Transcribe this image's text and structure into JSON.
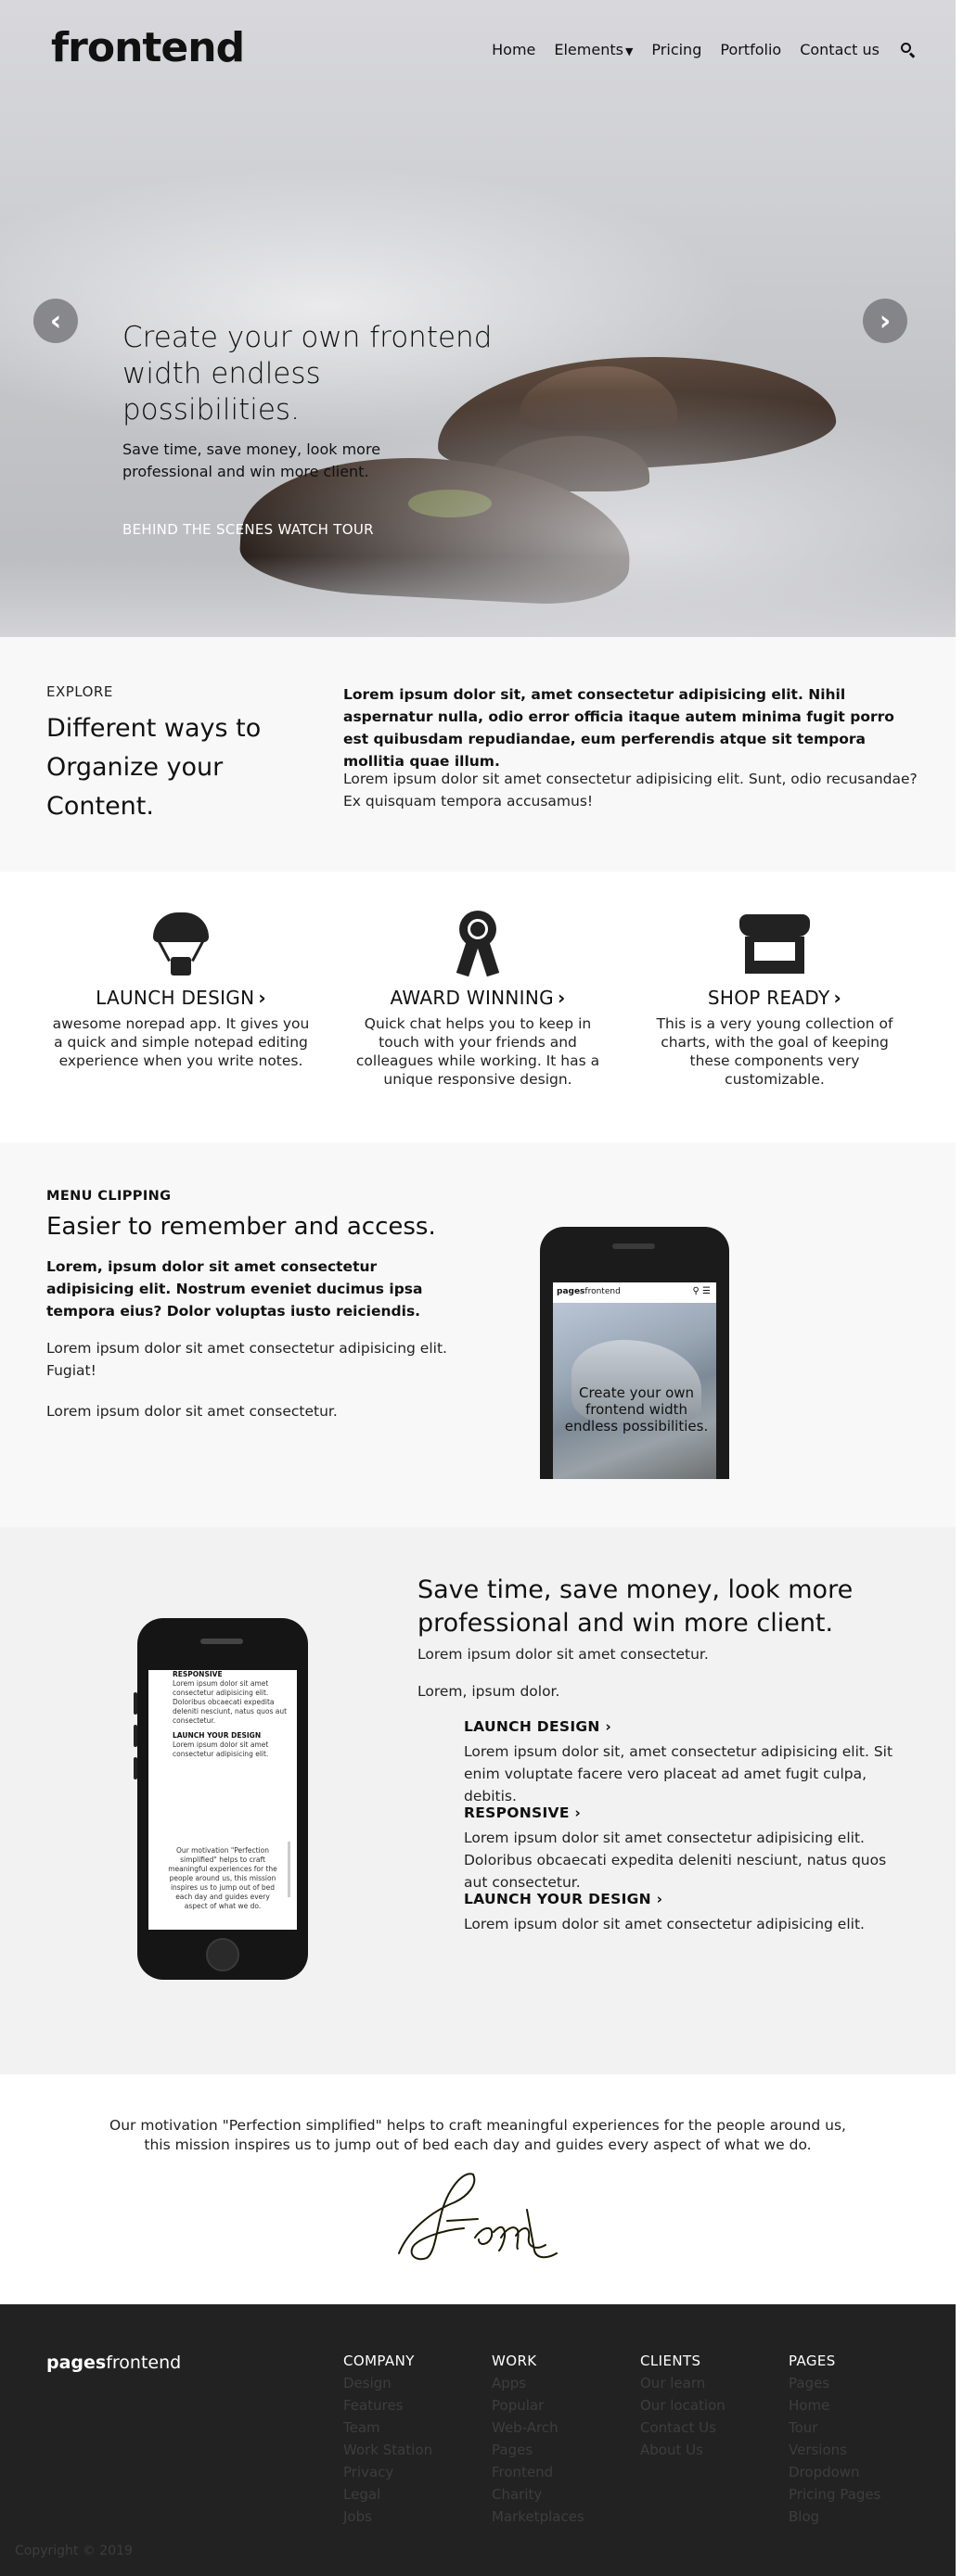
{
  "header": {
    "brand": "frontend",
    "nav": [
      "Home",
      "Elements",
      "Pricing",
      "Portfolio",
      "Contact us"
    ],
    "icons": [
      "search-icon",
      "chevron-down-icon"
    ]
  },
  "hero": {
    "title": "Create your own frontend width endless possibilities.",
    "subtitle": "Save time, save money, look more professional and win more client.",
    "link": "BEHIND THE SCENES WATCH TOUR",
    "prev": "‹",
    "next": "›"
  },
  "explore": {
    "eyebrow": "EXPLORE",
    "title": "Different ways to Organize your Content.",
    "bold": "Lorem ipsum dolor sit, amet consectetur adipisicing elit. Nihil aspernatur nulla, odio error officia itaque autem minima fugit porro est quibusdam repudiandae, eum perferendis atque sit tempora mollitia quae illum.",
    "para": "Lorem ipsum dolor sit amet consectetur adipisicing elit. Sunt, odio recusandae? Ex quisquam tempora accusamus!"
  },
  "features": [
    {
      "title": "LAUNCH DESIGN",
      "desc": "awesome norepad app. It gives you a quick and simple notepad editing experience when you write notes.",
      "icon": "parachute-icon"
    },
    {
      "title": "AWARD WINNING",
      "desc": "Quick chat helps you to keep in touch with your friends and colleagues while working. It has a unique responsive design.",
      "icon": "award-icon"
    },
    {
      "title": "SHOP READY",
      "desc": "This is a very young collection of charts, with the goal of keeping these components very customizable.",
      "icon": "shop-icon"
    }
  ],
  "clipping": {
    "eyebrow": "MENU CLIPPING",
    "title": "Easier to remember and access.",
    "bold": "Lorem, ipsum dolor sit amet consectetur adipisicing elit. Nostrum eveniet ducimus ipsa tempora eius? Dolor voluptas iusto reiciendis.",
    "p1": "Lorem ipsum dolor sit amet consectetur adipisicing elit. Fugiat!",
    "p2": "Lorem ipsum dolor sit amet consectetur.",
    "phone": {
      "logo_bold": "pages",
      "logo_rest": "frontend",
      "caption": "Create your own frontend width endless possibilities."
    }
  },
  "save": {
    "title": "Save time, save money, look more professional and win more client.",
    "p1": "Lorem ipsum dolor sit amet consectetur.",
    "p2": "Lorem, ipsum dolor.",
    "items": [
      {
        "title": "LAUNCH DESIGN",
        "desc": "Lorem ipsum dolor sit, amet consectetur adipisicing elit. Sit enim voluptate facere vero placeat ad amet fugit culpa, debitis."
      },
      {
        "title": "RESPONSIVE",
        "desc": "Lorem ipsum dolor sit amet consectetur adipisicing elit. Doloribus obcaecati expedita deleniti nesciunt, natus quos aut consectetur."
      },
      {
        "title": "LAUNCH YOUR DESIGN",
        "desc": "Lorem ipsum dolor sit amet consectetur adipisicing elit."
      }
    ],
    "phone": {
      "h1": "RESPONSIVE",
      "t1": "Lorem ipsum dolor sit amet consectetur adipisicing elit. Doloribus obcaecati expedita deleniti nesciunt, natus quos aut consectetur.",
      "h2": "LAUNCH YOUR DESIGN",
      "t2": "Lorem ipsum dolor sit amet consectetur adipisicing elit.",
      "quote": "Our motivation \"Perfection simplified\" helps to craft meaningful experiences for the people around us, this mission inspires us to jump out of bed each day and guides every aspect of what we do."
    }
  },
  "motivation": {
    "text": "Our motivation \"Perfection simplified\" helps to craft meaningful experiences for the people around us, this mission inspires us to jump out of bed each day and guides every aspect of what we do."
  },
  "footer": {
    "logo_bold": "pages",
    "logo_rest": "frontend",
    "columns": [
      {
        "title": "COMPANY",
        "links": [
          "Design",
          "Features",
          "Team",
          "Work Station",
          "Privacy",
          "Legal",
          "Jobs"
        ]
      },
      {
        "title": "WORK",
        "links": [
          "Apps",
          "Popular",
          "Web-Arch",
          "Pages",
          "Frontend",
          "Charity",
          "Marketplaces"
        ]
      },
      {
        "title": "CLIENTS",
        "links": [
          "Our learn",
          "Our location",
          "Contact Us",
          "About Us"
        ]
      },
      {
        "title": "PAGES",
        "links": [
          "Pages",
          "Home",
          "Tour",
          "Versions",
          "Dropdown",
          "Pricing Pages",
          "Blog"
        ]
      }
    ],
    "copyright": "Copyright © 2019"
  },
  "colors": {
    "dark": "#222222",
    "footer_link": "#3d3d3d",
    "signature": "#1a1a00"
  }
}
